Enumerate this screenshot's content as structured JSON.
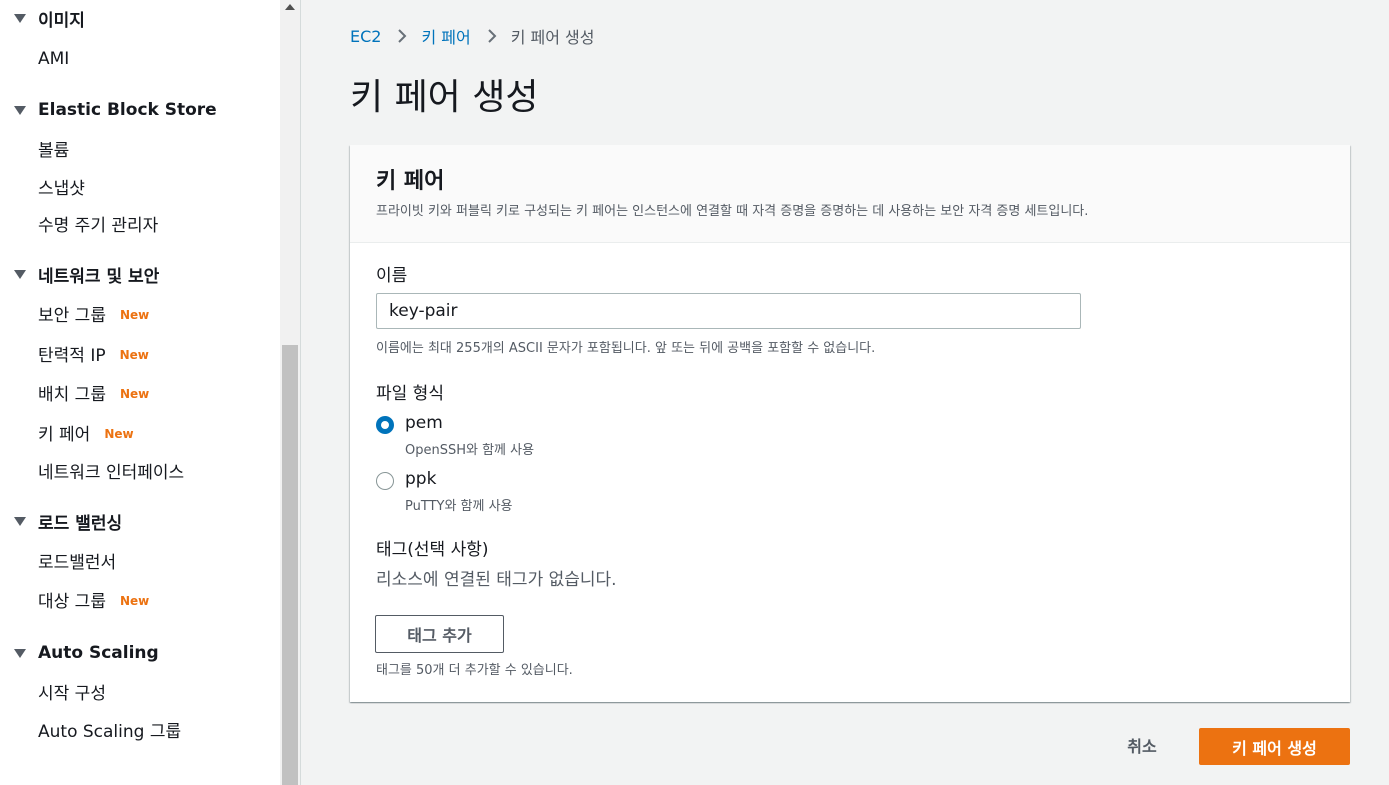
{
  "sidebar": {
    "sections": [
      {
        "title": "이미지",
        "items": [
          {
            "label": "AMI",
            "badge": ""
          }
        ]
      },
      {
        "title": "Elastic Block Store",
        "items": [
          {
            "label": "볼륨",
            "badge": ""
          },
          {
            "label": "스냅샷",
            "badge": ""
          },
          {
            "label": "수명 주기 관리자",
            "badge": ""
          }
        ]
      },
      {
        "title": "네트워크 및 보안",
        "items": [
          {
            "label": "보안 그룹",
            "badge": "New"
          },
          {
            "label": "탄력적 IP",
            "badge": "New"
          },
          {
            "label": "배치 그룹",
            "badge": "New"
          },
          {
            "label": "키 페어",
            "badge": "New"
          },
          {
            "label": "네트워크 인터페이스",
            "badge": ""
          }
        ]
      },
      {
        "title": "로드 밸런싱",
        "items": [
          {
            "label": "로드밸런서",
            "badge": ""
          },
          {
            "label": "대상 그룹",
            "badge": "New"
          }
        ]
      },
      {
        "title": "Auto Scaling",
        "items": [
          {
            "label": "시작 구성",
            "badge": ""
          },
          {
            "label": "Auto Scaling 그룹",
            "badge": ""
          }
        ]
      }
    ]
  },
  "breadcrumb": {
    "root": "EC2",
    "parent": "키 페어",
    "current": "키 페어 생성"
  },
  "page": {
    "title": "키 페어 생성"
  },
  "panel": {
    "title": "키 페어",
    "description": "프라이빗 키와 퍼블릭 키로 구성되는 키 페어는 인스턴스에 연결할 때 자격 증명을 증명하는 데 사용하는 보안 자격 증명 세트입니다."
  },
  "name_field": {
    "label": "이름",
    "value": "key-pair",
    "hint": "이름에는 최대 255개의 ASCII 문자가 포함됩니다. 앞 또는 뒤에 공백을 포함할 수 없습니다."
  },
  "file_format": {
    "label": "파일 형식",
    "selected": "pem",
    "options": [
      {
        "value": "pem",
        "label": "pem",
        "description": "OpenSSH와 함께 사용"
      },
      {
        "value": "ppk",
        "label": "ppk",
        "description": "PuTTY와 함께 사용"
      }
    ]
  },
  "tags": {
    "label": "태그(선택 사항)",
    "empty_text": "리소스에 연결된 태그가 없습니다.",
    "add_button": "태그 추가",
    "hint": "태그를 50개 더 추가할 수 있습니다."
  },
  "actions": {
    "cancel": "취소",
    "create": "키 페어 생성"
  },
  "colors": {
    "link": "#0073bb",
    "primary_button": "#ec7211",
    "new_badge": "#ec7211",
    "background": "#f2f3f3"
  }
}
